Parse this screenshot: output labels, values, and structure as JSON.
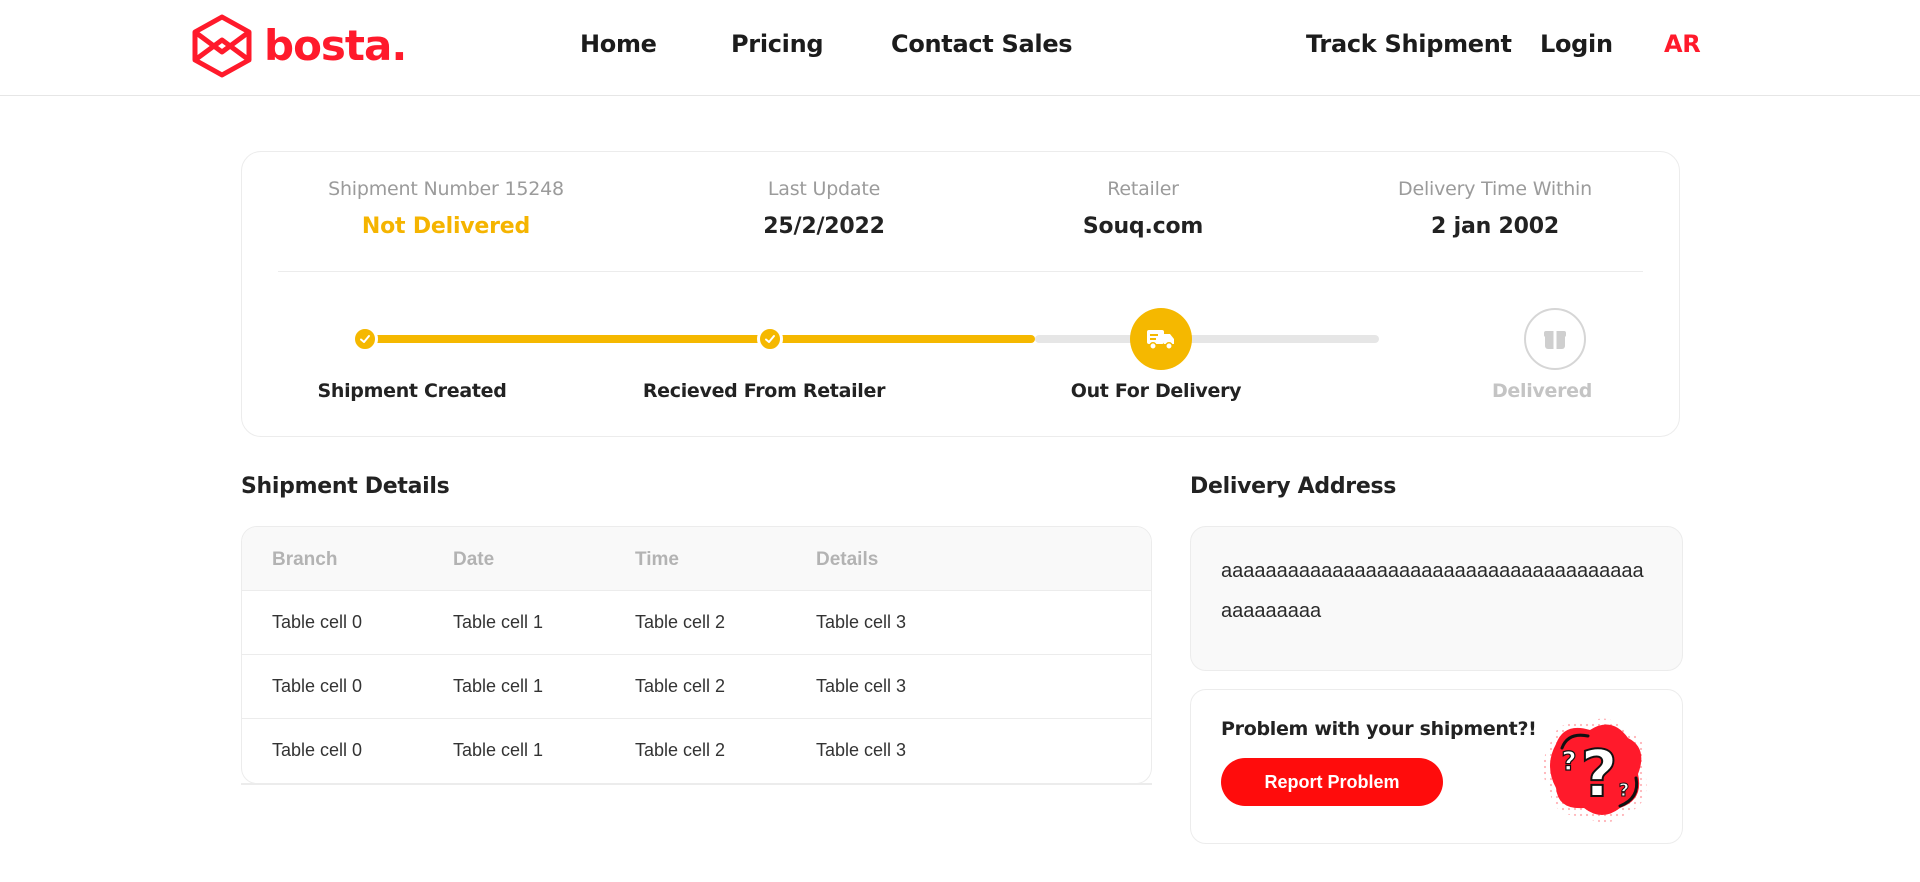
{
  "header": {
    "brand": "bosta",
    "brand_dot": ".",
    "nav": {
      "home": "Home",
      "pricing": "Pricing",
      "contact_sales": "Contact Sales",
      "track_shipment": "Track Shipment",
      "login": "Login",
      "language": "AR"
    }
  },
  "shipment": {
    "number_label": "Shipment Number 15248",
    "status": "Not Delivered",
    "last_update_label": "Last Update",
    "last_update_value": "25/2/2022",
    "retailer_label": "Retailer",
    "retailer_value": "Souq.com",
    "delivery_time_label": "Delivery Time Within",
    "delivery_time_value": "2 jan 2002"
  },
  "progress": {
    "steps": [
      {
        "label": "Shipment Created",
        "state": "done"
      },
      {
        "label": "Recieved From Retailer",
        "state": "done"
      },
      {
        "label": "Out For Delivery",
        "state": "current"
      },
      {
        "label": "Delivered",
        "state": "pending"
      }
    ],
    "colors": {
      "done": "#f5b800",
      "pending": "#e6e6e6"
    }
  },
  "details": {
    "title": "Shipment Details",
    "columns": [
      "Branch",
      "Date",
      "Time",
      "Details"
    ],
    "rows": [
      [
        "Table cell 0",
        "Table cell 1",
        "Table cell 2",
        "Table cell 3"
      ],
      [
        "Table cell 0",
        "Table cell 1",
        "Table cell 2",
        "Table cell 3"
      ],
      [
        "Table cell 0",
        "Table cell 1",
        "Table cell 2",
        "Table cell 3"
      ]
    ]
  },
  "address": {
    "title": "Delivery Address",
    "text": "aaaaaaaaaaaaaaaaaaaaaaaaaaaaaaaaaaaaaaaaaaaaaaa"
  },
  "problem": {
    "question": "Problem with your shipment?!",
    "button_label": "Report Problem"
  },
  "icons": {
    "logo": "bosta-box-logo-icon",
    "check": "check-icon",
    "truck": "delivery-truck-icon",
    "box": "package-box-icon",
    "question": "question-mark-illustration-icon"
  },
  "colors": {
    "brand": "#ff1a2b",
    "accent": "#f5b400",
    "button": "#ff0c0c"
  }
}
